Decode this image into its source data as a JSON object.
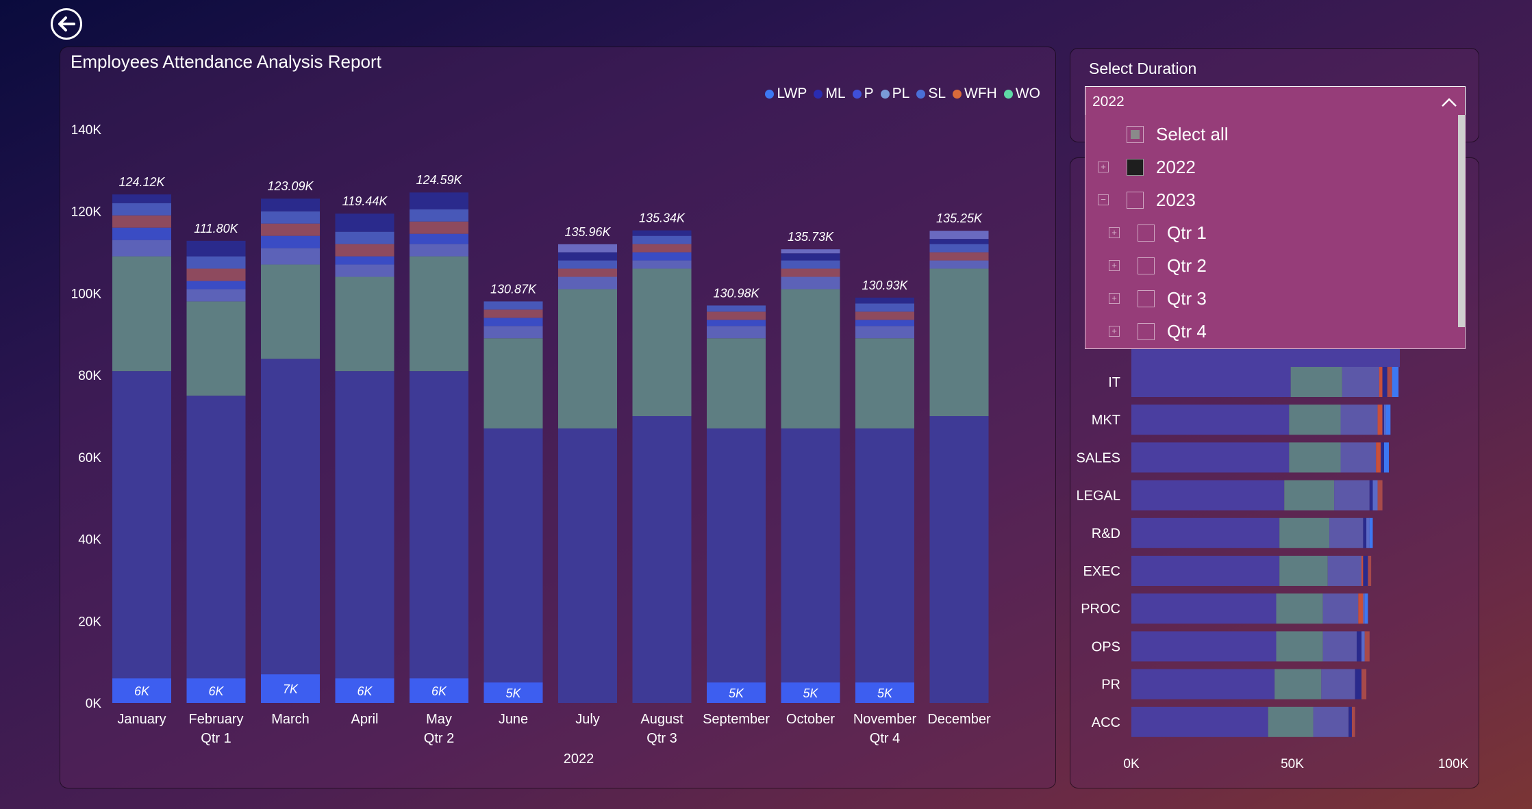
{
  "report": {
    "title": "Employees Attendance Analysis Report"
  },
  "legend": [
    {
      "label": "LWP",
      "color": "#3d78f2"
    },
    {
      "label": "ML",
      "color": "#2a2cb0"
    },
    {
      "label": "P",
      "color": "#3f4fd8"
    },
    {
      "label": "PL",
      "color": "#7a9bd8"
    },
    {
      "label": "SL",
      "color": "#4a70d8"
    },
    {
      "label": "WFH",
      "color": "#d96a3a"
    },
    {
      "label": "WO",
      "color": "#5fd9a6"
    }
  ],
  "chart_data": [
    {
      "type": "bar",
      "stacked": true,
      "categories": [
        "January",
        "February",
        "March",
        "April",
        "May",
        "June",
        "July",
        "August",
        "September",
        "October",
        "November",
        "December"
      ],
      "quarter_labels": [
        "",
        "Qtr 1",
        "",
        "",
        "Qtr 2",
        "",
        "",
        "Qtr 3",
        "",
        "",
        "Qtr 4",
        ""
      ],
      "xlabel": "2022",
      "y_ticks": [
        "0K",
        "20K",
        "40K",
        "60K",
        "80K",
        "100K",
        "120K",
        "140K"
      ],
      "ylim": [
        0,
        140000
      ],
      "totals": [
        "124.12K",
        "111.80K",
        "123.09K",
        "119.44K",
        "124.59K",
        "130.87K",
        "135.96K",
        "135.34K",
        "130.98K",
        "135.73K",
        "130.93K",
        "135.25K"
      ],
      "series": [
        {
          "name": "LWP",
          "values": [
            6000,
            6000,
            7000,
            6000,
            6000,
            5000,
            0,
            0,
            5000,
            5000,
            5000,
            0
          ],
          "labels": [
            "6K",
            "6K",
            "7K",
            "6K",
            "6K",
            "5K",
            "",
            "",
            "5K",
            "5K",
            "5K",
            ""
          ]
        },
        {
          "name": "P",
          "values": [
            75000,
            69000,
            77000,
            75000,
            75000,
            62000,
            67000,
            70000,
            62000,
            62000,
            62000,
            70000
          ]
        },
        {
          "name": "WO",
          "values": [
            28000,
            23000,
            23000,
            23000,
            28000,
            22000,
            34000,
            36000,
            22000,
            34000,
            22000,
            36000
          ]
        },
        {
          "name": "PL",
          "values": [
            4000,
            3000,
            4000,
            3000,
            3000,
            3000,
            3000,
            2000,
            3000,
            3000,
            3000,
            2000
          ]
        },
        {
          "name": "SL",
          "values": [
            3000,
            2000,
            3000,
            2000,
            2500,
            2000,
            0,
            2000,
            1500,
            0,
            1500,
            0
          ]
        },
        {
          "name": "WFH",
          "values": [
            3000,
            3000,
            3000,
            3000,
            3000,
            2000,
            2000,
            2000,
            2000,
            2000,
            2000,
            2000
          ]
        },
        {
          "name": "SL",
          "values": [
            3000,
            3000,
            3000,
            3000,
            3000,
            2000,
            2000,
            2000,
            1500,
            2000,
            2000,
            2000
          ]
        },
        {
          "name": "ML",
          "values": [
            2120,
            3800,
            3090,
            4440,
            4090,
            0,
            2000,
            1340,
            0,
            1730,
            1430,
            1250
          ]
        },
        {
          "name": "PL",
          "values": [
            0,
            0,
            0,
            0,
            0,
            0,
            1960,
            0,
            0,
            1000,
            0,
            2000
          ]
        },
        {
          "name": "LWP",
          "values": [
            0,
            0,
            0,
            0,
            0,
            0,
            0,
            0,
            0,
            0,
            0,
            0
          ]
        }
      ],
      "colors": [
        "#3d5ef0",
        "#3e3a96",
        "#5e7e82",
        "#5c62b8",
        "#3a4cc4",
        "#8e4a5e",
        "#4858b8",
        "#2a2a8c",
        "#6a6ac0",
        "#3d78f2"
      ]
    },
    {
      "type": "bar",
      "orientation": "horizontal",
      "stacked": true,
      "categories": [
        "IT",
        "MKT",
        "SALES",
        "LEGAL",
        "R&D",
        "EXEC",
        "PROC",
        "OPS",
        "PR",
        "ACC"
      ],
      "x_ticks": [
        "0K",
        "50K",
        "100K"
      ],
      "xlim": [
        0,
        100000
      ],
      "series": [
        {
          "name": "P",
          "values": [
            49500,
            49000,
            49000,
            47500,
            46000,
            46000,
            45000,
            45000,
            44500,
            42500
          ]
        },
        {
          "name": "WO",
          "values": [
            16000,
            16000,
            16000,
            15500,
            15500,
            15000,
            14500,
            14500,
            14500,
            14000
          ]
        },
        {
          "name": "PL",
          "values": [
            11500,
            11500,
            11000,
            11000,
            10500,
            10500,
            11000,
            10500,
            10500,
            11000
          ]
        },
        {
          "name": "WFH",
          "values": [
            1000,
            1500,
            1500,
            0,
            0,
            500,
            1500,
            0,
            0,
            0
          ]
        },
        {
          "name": "ML",
          "values": [
            1500,
            500,
            1000,
            1000,
            1000,
            1500,
            0,
            1500,
            2000,
            1000
          ]
        },
        {
          "name": "SL",
          "values": [
            0,
            500,
            0,
            1500,
            1000,
            0,
            500,
            1000,
            0,
            0
          ]
        },
        {
          "name": "WFH",
          "values": [
            1500,
            0,
            0,
            1500,
            0,
            1000,
            0,
            1500,
            1500,
            1000
          ]
        },
        {
          "name": "LWP",
          "values": [
            2000,
            1500,
            1500,
            0,
            1000,
            0,
            1000,
            0,
            0,
            0
          ]
        }
      ],
      "colors": [
        "#4a3ea0",
        "#5e7e82",
        "#5c58a8",
        "#c9503a",
        "#2a2a8c",
        "#5a6ac8",
        "#a84a4a",
        "#3d78f2"
      ]
    }
  ],
  "duration": {
    "label": "Select Duration",
    "selected": "2022",
    "options": [
      {
        "label": "Select all",
        "level": 0,
        "state": "partial",
        "expander": ""
      },
      {
        "label": "2022",
        "level": 0,
        "state": "checked",
        "expander": "+"
      },
      {
        "label": "2023",
        "level": 0,
        "state": "unchecked",
        "expander": "−"
      },
      {
        "label": "Qtr 1",
        "level": 1,
        "state": "unchecked",
        "expander": "+"
      },
      {
        "label": "Qtr 2",
        "level": 1,
        "state": "unchecked",
        "expander": "+"
      },
      {
        "label": "Qtr 3",
        "level": 1,
        "state": "unchecked",
        "expander": "+"
      },
      {
        "label": "Qtr 4",
        "level": 1,
        "state": "unchecked",
        "expander": "+"
      }
    ]
  }
}
